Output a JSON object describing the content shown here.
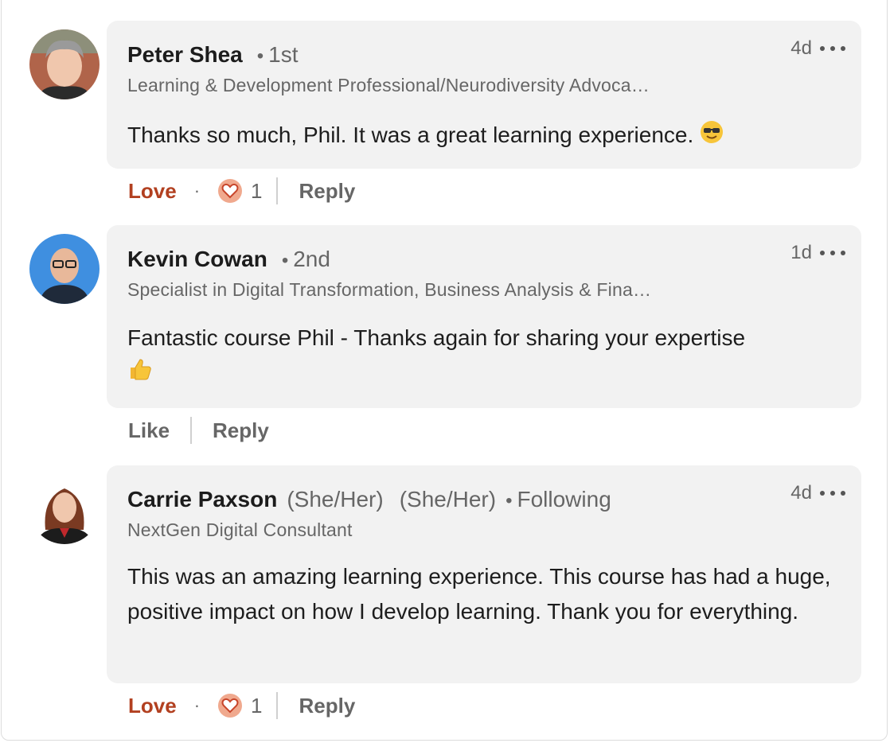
{
  "comments": [
    {
      "name": "Peter Shea",
      "degree": "1st",
      "headline": "Learning & Development Professional/Neurodiversity Advoca…",
      "text": "Thanks so much, Phil. It was a great learning experience.",
      "emoji": "sunglasses-face",
      "time": "4d",
      "reaction_label": "Love",
      "reaction_count": "1",
      "reply_label": "Reply"
    },
    {
      "name": "Kevin Cowan",
      "degree": "2nd",
      "headline": "Specialist in Digital Transformation, Business Analysis & Fina…",
      "text": "Fantastic course Phil - Thanks again for sharing your expertise",
      "emoji": "thumbs-up",
      "time": "1d",
      "reaction_label": "Like",
      "reply_label": "Reply"
    },
    {
      "name": "Carrie Paxson",
      "pronouns": "(She/Her)",
      "pronouns_2": "(She/Her)",
      "degree": "Following",
      "headline": "NextGen Digital Consultant",
      "text": "This was an amazing learning experience. This course has had a huge, positive impact on how I develop learning. Thank you for everything.",
      "time": "4d",
      "reaction_label": "Love",
      "reaction_count": "1",
      "reply_label": "Reply"
    }
  ],
  "colors": {
    "bubble": "#f2f2f2",
    "love": "#b24020",
    "muted": "#666666"
  }
}
